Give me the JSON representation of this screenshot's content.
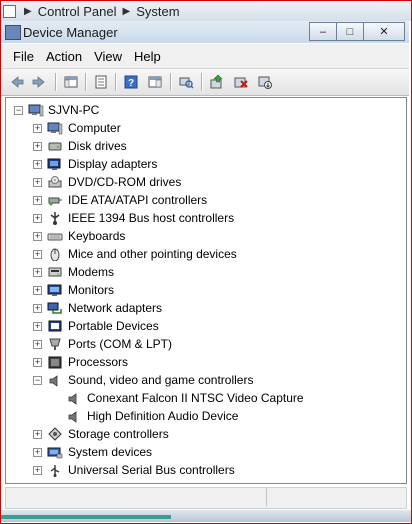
{
  "breadcrumb": {
    "items": [
      "Control Panel",
      "System"
    ]
  },
  "window": {
    "title": "Device Manager",
    "minimize_glyph": "–",
    "maximize_glyph": "□",
    "close_glyph": "✕"
  },
  "menu": [
    "File",
    "Action",
    "View",
    "Help"
  ],
  "toolbar": {
    "icons": [
      "back-arrow-icon",
      "forward-arrow-icon",
      "console-tree-icon",
      "properties-icon",
      "help-icon",
      "action-pane-icon",
      "scan-hardware-icon",
      "update-driver-icon",
      "uninstall-icon",
      "disable-icon"
    ]
  },
  "tree": {
    "root": "SJVN-PC",
    "categories": [
      {
        "label": "Computer",
        "icon": "computer-icon"
      },
      {
        "label": "Disk drives",
        "icon": "disk-drive-icon"
      },
      {
        "label": "Display adapters",
        "icon": "display-adapter-icon"
      },
      {
        "label": "DVD/CD-ROM drives",
        "icon": "dvd-drive-icon"
      },
      {
        "label": "IDE ATA/ATAPI controllers",
        "icon": "ide-controller-icon"
      },
      {
        "label": "IEEE 1394 Bus host controllers",
        "icon": "ieee1394-icon"
      },
      {
        "label": "Keyboards",
        "icon": "keyboard-icon"
      },
      {
        "label": "Mice and other pointing devices",
        "icon": "mouse-icon"
      },
      {
        "label": "Modems",
        "icon": "modem-icon"
      },
      {
        "label": "Monitors",
        "icon": "monitor-icon"
      },
      {
        "label": "Network adapters",
        "icon": "network-adapter-icon"
      },
      {
        "label": "Portable Devices",
        "icon": "portable-device-icon"
      },
      {
        "label": "Ports (COM & LPT)",
        "icon": "port-icon"
      },
      {
        "label": "Processors",
        "icon": "processor-icon"
      },
      {
        "label": "Sound, video and game controllers",
        "icon": "speaker-icon",
        "expanded": true,
        "children": [
          {
            "label": "Conexant Falcon II NTSC Video Capture",
            "icon": "speaker-icon"
          },
          {
            "label": "High Definition Audio Device",
            "icon": "speaker-icon"
          }
        ]
      },
      {
        "label": "Storage controllers",
        "icon": "storage-controller-icon"
      },
      {
        "label": "System devices",
        "icon": "system-device-icon"
      },
      {
        "label": "Universal Serial Bus controllers",
        "icon": "usb-icon"
      }
    ]
  },
  "colors": {
    "frame_border": "#d40000",
    "titlebar": "#c9d9ea",
    "tree_border": "#828790"
  }
}
